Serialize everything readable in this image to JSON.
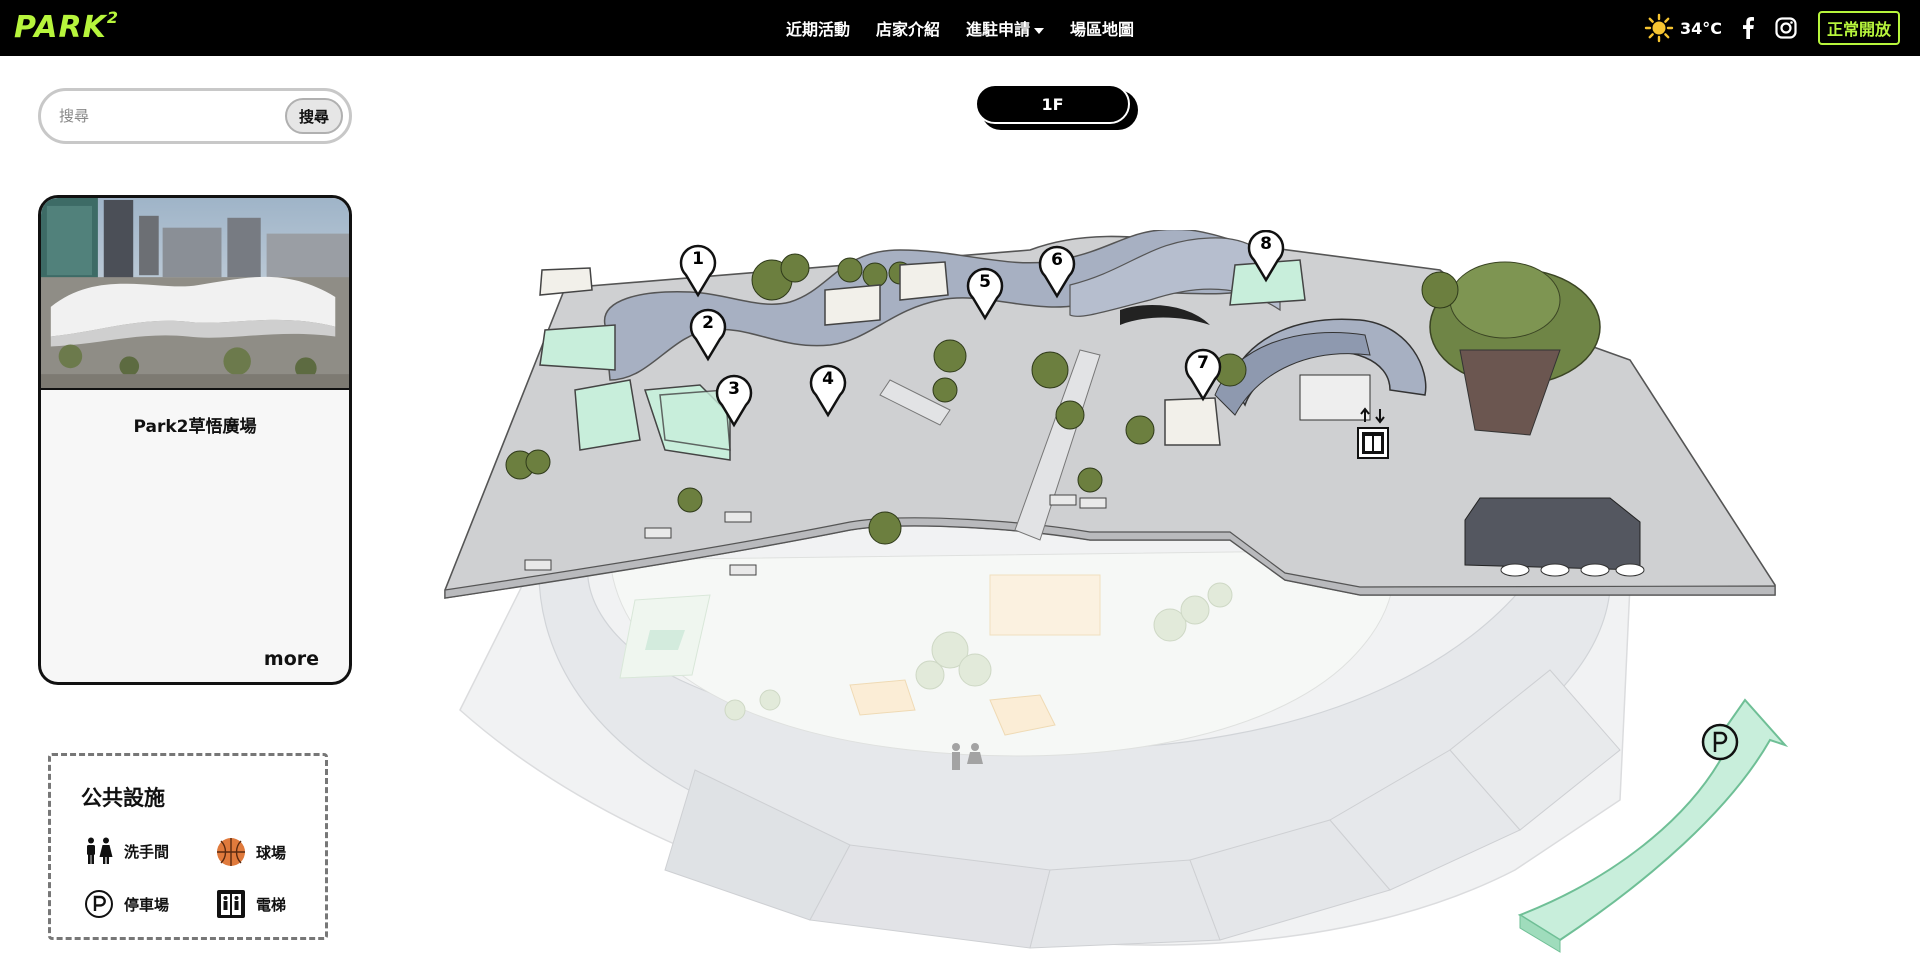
{
  "header": {
    "logo_text": "PARK",
    "logo_sup": "2",
    "nav": [
      {
        "label": "近期活動"
      },
      {
        "label": "店家介紹"
      },
      {
        "label": "進駐申請",
        "has_dropdown": true
      },
      {
        "label": "場區地圖"
      }
    ],
    "weather": {
      "icon": "sun-icon",
      "temperature": "34°C"
    },
    "social": [
      "facebook-icon",
      "instagram-icon"
    ],
    "status": "正常開放",
    "accent_color": "#b7f53c"
  },
  "search": {
    "placeholder": "搜尋",
    "button_label": "搜尋"
  },
  "venue_card": {
    "name": "Park2草悟廣場",
    "more_label": "more"
  },
  "facilities": {
    "title": "公共設施",
    "items": [
      {
        "label": "洗手間",
        "icon": "restroom-icon"
      },
      {
        "label": "球場",
        "icon": "basketball-icon"
      },
      {
        "label": "停車場",
        "icon": "parking-icon"
      },
      {
        "label": "電梯",
        "icon": "elevator-icon"
      }
    ]
  },
  "floor": {
    "label": "1F"
  },
  "map": {
    "store_markers": [
      "1",
      "2",
      "3",
      "4",
      "5",
      "6",
      "7",
      "8"
    ],
    "colors": {
      "building_mint": "#c8eedb",
      "water": "#a7b0c2",
      "ground": "#cfd0d2",
      "lower_ground": "#e5e7ea"
    }
  }
}
